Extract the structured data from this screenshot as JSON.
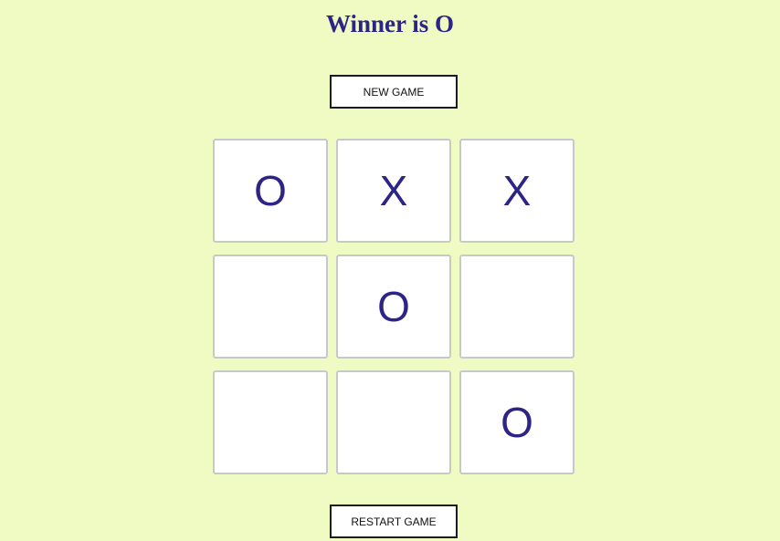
{
  "status": {
    "title": "Winner is O"
  },
  "controls": {
    "new_game_label": "NEW GAME",
    "restart_game_label": "RESTART GAME"
  },
  "board": {
    "cells": [
      "O",
      "X",
      "X",
      "",
      "O",
      "",
      "",
      "",
      "O"
    ]
  },
  "colors": {
    "background": "#f0fbc4",
    "mark": "#2d2585",
    "title": "#2d2585"
  }
}
